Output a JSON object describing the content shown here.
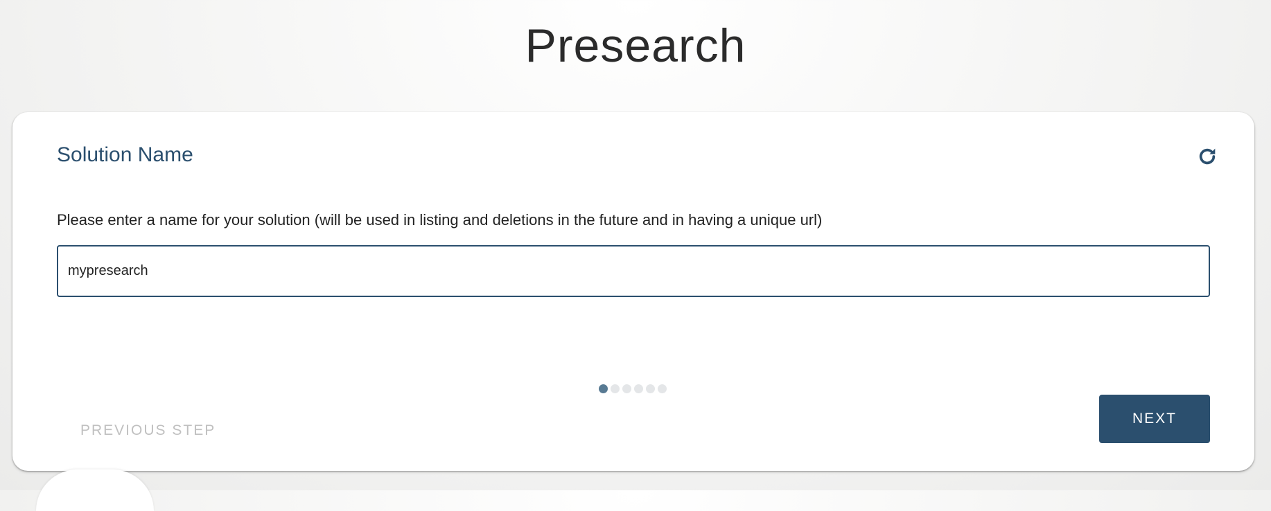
{
  "header": {
    "title": "Presearch"
  },
  "step": {
    "title": "Solution Name",
    "refresh_icon": "refresh-icon",
    "prompt": "Please enter a name for your solution (will be used in listing and deletions in the future and in having a unique url)",
    "input_value": "mypresearch"
  },
  "progress": {
    "total_steps": 6,
    "current_step": 1
  },
  "navigation": {
    "previous_label": "PREVIOUS STEP",
    "next_label": "NEXT"
  },
  "colors": {
    "accent": "#2b4f6e",
    "active_dot": "#587a93",
    "inactive_dot": "#e4e6e8",
    "disabled_text": "#c0c0c0"
  }
}
